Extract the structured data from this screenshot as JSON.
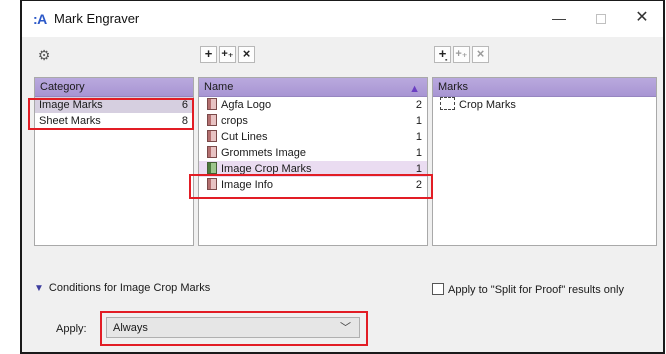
{
  "window": {
    "app_icon": ":A",
    "title": "Mark Engraver",
    "controls": {
      "minimize": "—",
      "close": "✕"
    }
  },
  "toolbars": {
    "category": {
      "gear_icon": "gear-icon",
      "gear_glyph": "⚙"
    },
    "names": {
      "add": "+",
      "add_multi": "+₊",
      "remove": "×"
    },
    "marks": {
      "add": "+̣",
      "add_multi": "+₊",
      "remove": "×"
    }
  },
  "category_panel": {
    "header": "Category",
    "rows": [
      {
        "label": "Image Marks",
        "count": "6",
        "selected": true
      },
      {
        "label": "Sheet Marks",
        "count": "8",
        "selected": false
      }
    ]
  },
  "name_panel": {
    "header": "Name",
    "sort_indicator": "▲",
    "rows": [
      {
        "label": "Agfa Logo",
        "count": "2"
      },
      {
        "label": "crops",
        "count": "1"
      },
      {
        "label": "Cut Lines",
        "count": "1"
      },
      {
        "label": "Grommets Image",
        "count": "1"
      },
      {
        "label": "Image Crop Marks",
        "count": "1"
      },
      {
        "label": "Image Info",
        "count": "2"
      }
    ]
  },
  "marks_panel": {
    "header": "Marks",
    "rows": [
      {
        "label": "Crop Marks"
      }
    ]
  },
  "conditions": {
    "label": "Conditions for Image Crop Marks",
    "split_checkbox_label": "Apply to \"Split for Proof\" results only",
    "split_checked": false
  },
  "apply": {
    "label": "Apply:",
    "value": "Always"
  },
  "colors": {
    "header_purple": "#a895d3",
    "annotation_red": "#e21d25",
    "selection": "#d6cfe0"
  }
}
